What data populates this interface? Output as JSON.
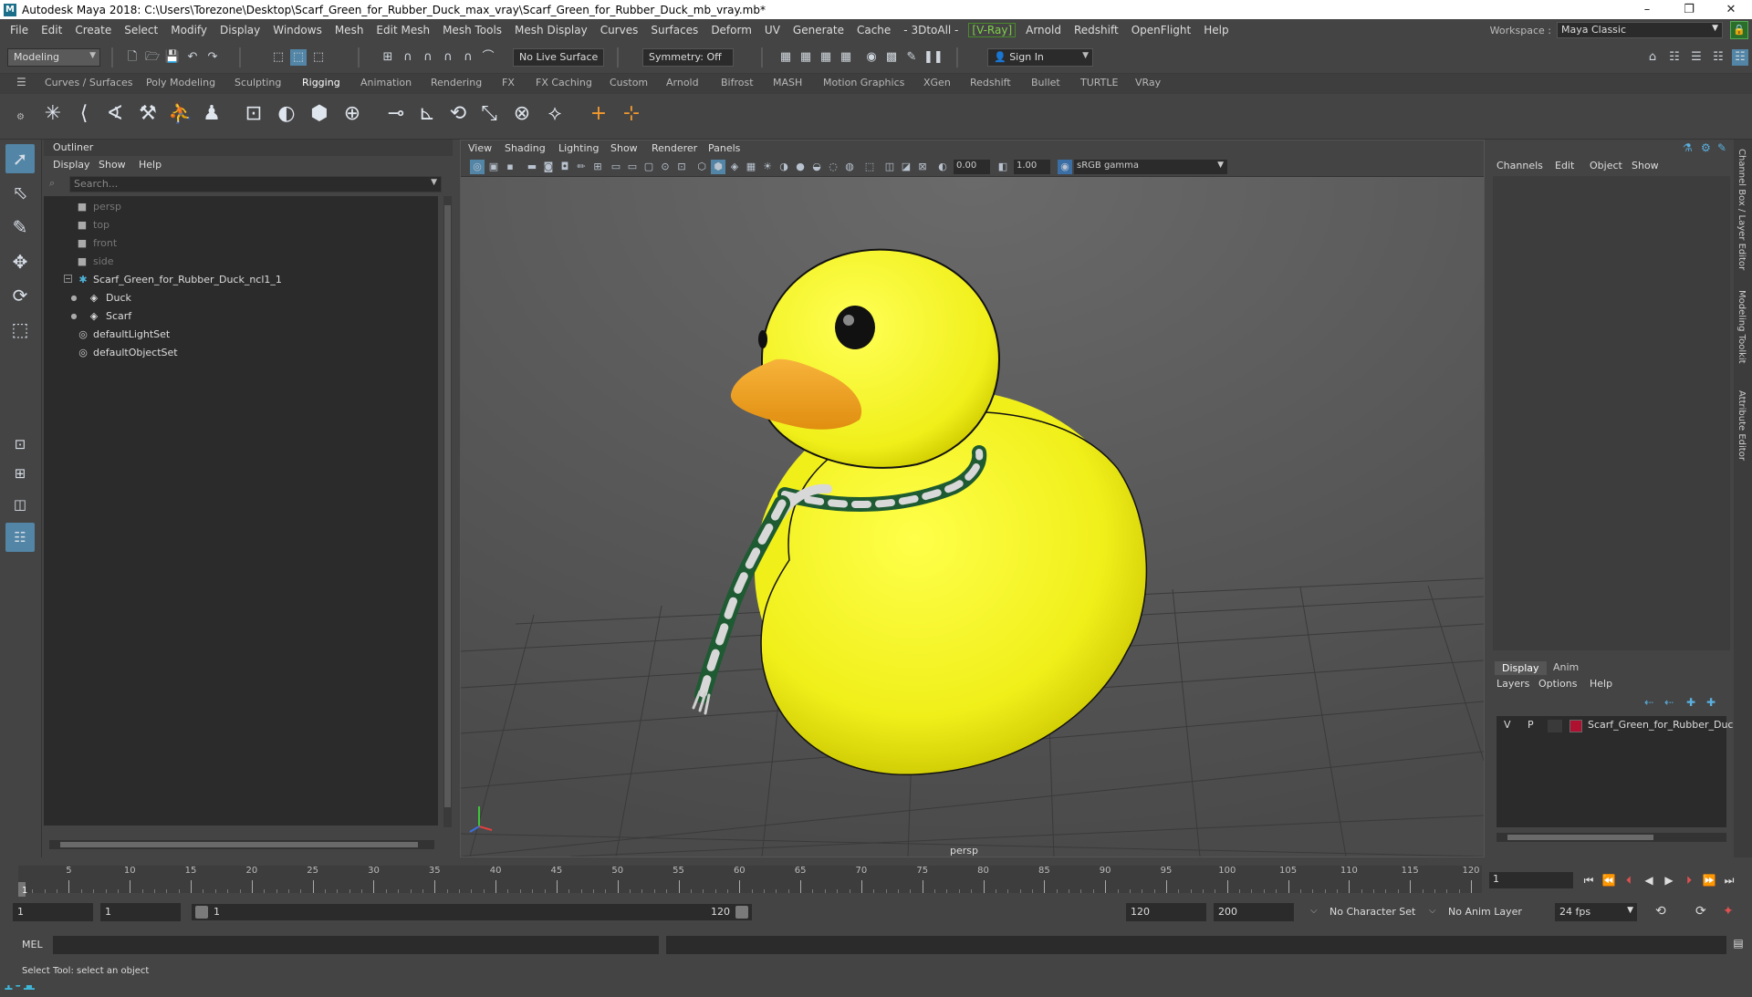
{
  "window": {
    "title": "Autodesk Maya 2018: C:\\Users\\Torezone\\Desktop\\Scarf_Green_for_Rubber_Duck_max_vray\\Scarf_Green_for_Rubber_Duck_mb_vray.mb*",
    "logo": "M"
  },
  "menu": {
    "items": [
      "File",
      "Edit",
      "Create",
      "Select",
      "Modify",
      "Display",
      "Windows",
      "Mesh",
      "Edit Mesh",
      "Mesh Tools",
      "Mesh Display",
      "Curves",
      "Surfaces",
      "Deform",
      "UV",
      "Generate",
      "Cache",
      "- 3DtoAll -",
      "[V-Ray]",
      "Arnold",
      "Redshift",
      "OpenFlight",
      "Help"
    ],
    "workspace_label": "Workspace :",
    "workspace_value": "Maya Classic"
  },
  "status": {
    "mode": "Modeling",
    "live_surface": "No Live Surface",
    "symmetry": "Symmetry: Off",
    "sign_in": "Sign In"
  },
  "shelf_tabs": {
    "items": [
      "Curves / Surfaces",
      "Poly Modeling",
      "Sculpting",
      "Rigging",
      "Animation",
      "Rendering",
      "FX",
      "FX Caching",
      "Custom",
      "Arnold",
      "Bifrost",
      "MASH",
      "Motion Graphics",
      "XGen",
      "Redshift",
      "Bullet",
      "TURTLE",
      "VRay"
    ],
    "active": "Rigging"
  },
  "outliner": {
    "title": "Outliner",
    "menu": [
      "Display",
      "Show",
      "Help"
    ],
    "search_placeholder": "Search...",
    "items": [
      {
        "label": "persp",
        "type": "camera",
        "depth": 0
      },
      {
        "label": "top",
        "type": "camera",
        "depth": 0
      },
      {
        "label": "front",
        "type": "camera",
        "depth": 0
      },
      {
        "label": "side",
        "type": "camera",
        "depth": 0
      },
      {
        "label": "Scarf_Green_for_Rubber_Duck_ncl1_1",
        "type": "group",
        "depth": 0,
        "expanded": true
      },
      {
        "label": "Duck",
        "type": "mesh",
        "depth": 1
      },
      {
        "label": "Scarf",
        "type": "mesh",
        "depth": 1
      },
      {
        "label": "defaultLightSet",
        "type": "set",
        "depth": 0
      },
      {
        "label": "defaultObjectSet",
        "type": "set",
        "depth": 0
      }
    ]
  },
  "viewport": {
    "menu": [
      "View",
      "Shading",
      "Lighting",
      "Show",
      "Renderer",
      "Panels"
    ],
    "exposure": "0.00",
    "gamma": "1.00",
    "color_space": "sRGB gamma",
    "camera_label": "persp"
  },
  "channel_box": {
    "menu": [
      "Channels",
      "Edit",
      "Object",
      "Show"
    ],
    "side_tabs": [
      "Channel Box / Layer Editor",
      "Modeling Toolkit",
      "Attribute Editor"
    ]
  },
  "layer_editor": {
    "tabs": [
      "Display",
      "Anim"
    ],
    "active_tab": "Display",
    "menu": [
      "Layers",
      "Options",
      "Help"
    ],
    "layers": [
      {
        "visible": "V",
        "playback": "P",
        "name": "Scarf_Green_for_Rubber_Duck",
        "color": "#b01030"
      }
    ]
  },
  "timeline": {
    "ticks": [
      5,
      10,
      15,
      20,
      25,
      30,
      35,
      40,
      45,
      50,
      55,
      60,
      65,
      70,
      75,
      80,
      85,
      90,
      95,
      100,
      105,
      110,
      115,
      120
    ],
    "current_frame": "1",
    "current_frame_field": "1",
    "start": 1,
    "end": 120
  },
  "range": {
    "start_field": "1",
    "playback_start": "1",
    "slider_start": "1",
    "slider_end": "120",
    "playback_end": "120",
    "end_field": "200",
    "character_set": "No Character Set",
    "anim_layer": "No Anim Layer",
    "fps": "24 fps"
  },
  "command": {
    "label": "MEL"
  },
  "help_line": {
    "text": "Select Tool: select an object"
  },
  "colors": {
    "duck": "#f0ef1a",
    "beak": "#f2a51c",
    "scarf_green": "#1e5a32",
    "scarf_white": "#d8d8d8",
    "accent": "#5285a6"
  }
}
